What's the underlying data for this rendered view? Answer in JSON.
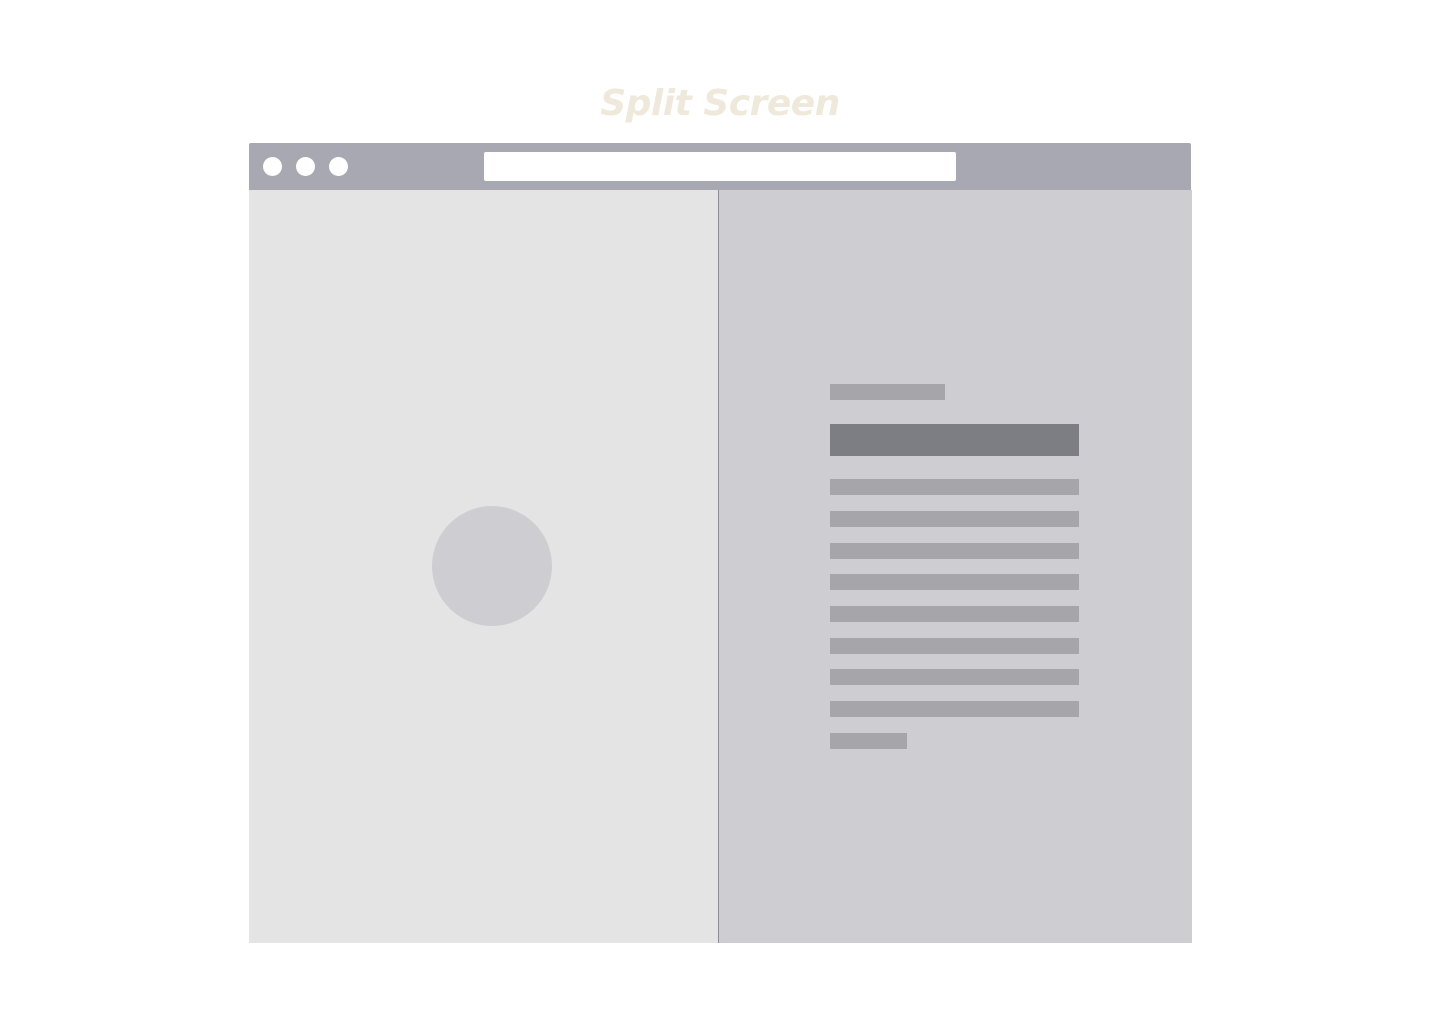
{
  "page": {
    "title": "Split Screen"
  },
  "colors": {
    "title": "#efe9db",
    "titlebar": "#a8a8b2",
    "left_pane": "#e4e4e5",
    "right_pane": "#cecdd2",
    "media_placeholder": "#cecdd2",
    "eyebrow_bar": "#a5a5aa",
    "heading_bar": "#7c7e83",
    "text_bar": "#a5a5aa"
  }
}
